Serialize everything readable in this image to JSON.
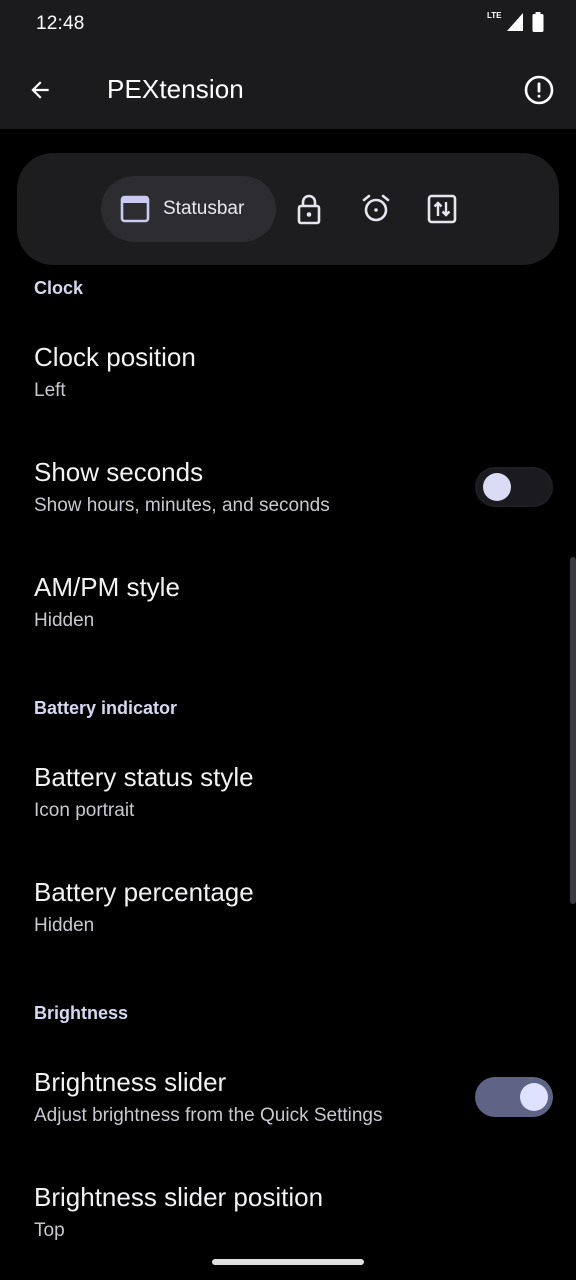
{
  "status_bar": {
    "time": "12:48",
    "network": "LTE",
    "icons": [
      "lte-signal-icon",
      "battery-icon"
    ]
  },
  "app_bar": {
    "title": "PEXtension",
    "back_icon": "arrow-back-icon",
    "info_icon": "info-icon"
  },
  "tabs": {
    "selected": "Statusbar",
    "items": [
      {
        "label": "Statusbar",
        "icon": "window-icon"
      },
      {
        "label": "",
        "icon": "lock-icon"
      },
      {
        "label": "",
        "icon": "alarm-icon"
      },
      {
        "label": "",
        "icon": "quick-settings-icon"
      }
    ]
  },
  "sections": [
    {
      "header": "Clock",
      "prefs": [
        {
          "title": "Clock position",
          "summary": "Left"
        },
        {
          "title": "Show seconds",
          "summary": "Show hours, minutes, and seconds",
          "switch": false
        },
        {
          "title": "AM/PM style",
          "summary": "Hidden"
        }
      ]
    },
    {
      "header": "Battery indicator",
      "prefs": [
        {
          "title": "Battery status style",
          "summary": "Icon portrait"
        },
        {
          "title": "Battery percentage",
          "summary": "Hidden"
        }
      ]
    },
    {
      "header": "Brightness",
      "prefs": [
        {
          "title": "Brightness slider",
          "summary": "Adjust brightness from the Quick Settings",
          "switch": true
        },
        {
          "title": "Brightness slider position",
          "summary": "Top"
        }
      ]
    }
  ],
  "colors": {
    "background": "#000000",
    "app_bar": "#1b1b1e",
    "section_header": "#d6d8f2",
    "switch_on_track": "#5f6486",
    "switch_thumb": "#dfe2ff"
  }
}
